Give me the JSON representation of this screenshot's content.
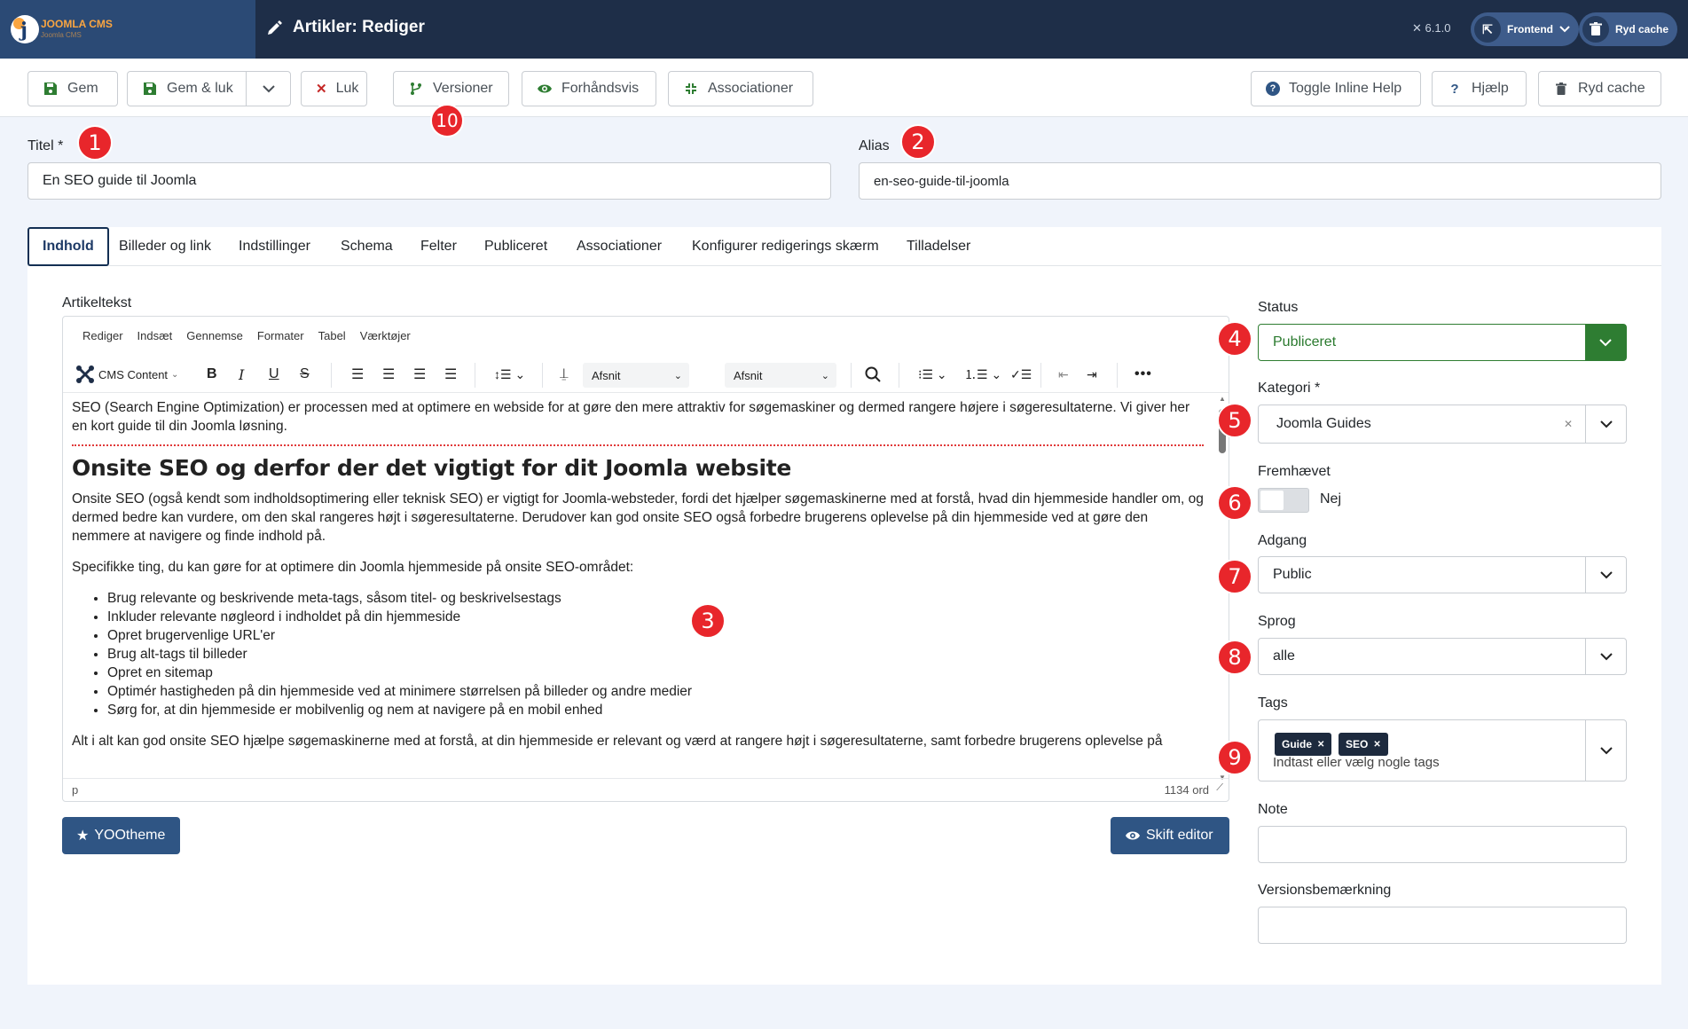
{
  "header": {
    "logo_text": "JOOMLA CMS",
    "logo_sub": "Joomla CMS",
    "title": "Artikler: Rediger",
    "version": "6.1.0",
    "frontend_label": "Frontend",
    "clear_cache_label": "Ryd cache"
  },
  "toolbar": {
    "save": "Gem",
    "save_close": "Gem & luk",
    "close": "Luk",
    "versions": "Versioner",
    "preview": "Forhåndsvis",
    "associations": "Associationer",
    "toggle_help": "Toggle Inline Help",
    "help": "Hjælp",
    "clear_cache": "Ryd cache"
  },
  "form": {
    "title_label": "Titel *",
    "title_value": "En SEO guide til Joomla",
    "alias_label": "Alias",
    "alias_value": "en-seo-guide-til-joomla"
  },
  "badges": [
    "1",
    "2",
    "3",
    "4",
    "5",
    "6",
    "7",
    "8",
    "9",
    "10"
  ],
  "tabs": [
    "Indhold",
    "Billeder og link",
    "Indstillinger",
    "Schema",
    "Felter",
    "Publiceret",
    "Associationer",
    "Konfigurer redigerings skærm",
    "Tilladelser"
  ],
  "editor": {
    "label": "Artikeltekst",
    "menu": [
      "Rediger",
      "Indsæt",
      "Gennemse",
      "Formater",
      "Tabel",
      "Værktøjer"
    ],
    "cms_content": "CMS Content",
    "block_format": "Afsnit",
    "font_format": "Afsnit",
    "intro": "SEO (Search Engine Optimization) er processen med at optimere en webside for at gøre den mere attraktiv for søgemaskiner og dermed rangere højere i søgeresultaterne. Vi giver her en kort guide til din Joomla løsning.",
    "heading": "Onsite SEO og derfor der det vigtigt for dit Joomla website",
    "para1": "Onsite SEO (også kendt som indholdsoptimering eller teknisk SEO) er vigtigt for Joomla-websteder, fordi det hjælper søgemaskinerne med at forstå, hvad din hjemmeside handler om, og dermed bedre kan vurdere, om den skal rangeres højt i søgeresultaterne. Derudover kan god onsite SEO også forbedre brugerens oplevelse på din hjemmeside ved at gøre den nemmere at navigere og finde indhold på.",
    "para2": "Specifikke ting, du kan gøre for at optimere din Joomla hjemmeside på onsite SEO-området:",
    "list": [
      "Brug relevante og beskrivende meta-tags, såsom titel- og beskrivelsestags",
      "Inkluder relevante nøgleord i indholdet på din hjemmeside",
      "Opret brugervenlige URL'er",
      "Brug alt-tags til billeder",
      "Opret en sitemap",
      "Optimér hastigheden på din hjemmeside ved at minimere størrelsen på billeder og andre medier",
      "Sørg for, at din hjemmeside er mobilvenlig og nem at navigere på en mobil enhed"
    ],
    "para3": "Alt i alt kan god onsite SEO hjælpe søgemaskinerne med at forstå, at din hjemmeside er relevant og værd at rangere højt i søgeresultaterne, samt forbedre brugerens oplevelse på",
    "path": "p",
    "word_count": "1134 ord"
  },
  "buttons": {
    "yootheme": "YOOtheme",
    "toggle_editor": "Skift editor"
  },
  "sidebar": {
    "status_label": "Status",
    "status_value": "Publiceret",
    "category_label": "Kategori *",
    "category_value": "Joomla Guides",
    "featured_label": "Fremhævet",
    "featured_value": "Nej",
    "access_label": "Adgang",
    "access_value": "Public",
    "language_label": "Sprog",
    "language_value": "alle",
    "tags_label": "Tags",
    "tags": [
      "Guide",
      "SEO"
    ],
    "tags_placeholder": "Indtast eller vælg nogle tags",
    "note_label": "Note",
    "version_note_label": "Versionsbemærkning"
  },
  "colors": {
    "header_bg": "#1e2e48",
    "logo_bg": "#2b4a75",
    "accent_blue": "#2f5584",
    "badge_red": "#e8262b",
    "status_green": "#2e7d32"
  }
}
